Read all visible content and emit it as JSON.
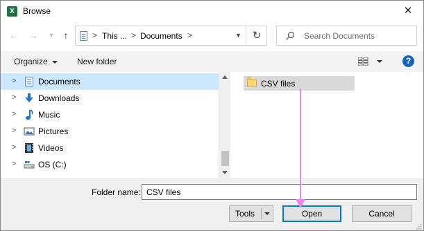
{
  "window": {
    "title": "Browse",
    "app_icon": "excel-icon",
    "close_glyph": "✕"
  },
  "nav": {
    "back_icon": "arrow-left-icon",
    "forward_icon": "arrow-right-icon",
    "recent_icon": "chevron-down-icon",
    "up_icon": "arrow-up-icon"
  },
  "address": {
    "crumbs": [
      "This ...",
      "Documents"
    ],
    "refresh_icon": "refresh-icon"
  },
  "search": {
    "placeholder": "Search Documents"
  },
  "toolbar": {
    "organize_label": "Organize",
    "new_folder_label": "New folder",
    "help_label": "?"
  },
  "sidebar": {
    "items": [
      {
        "label": "Documents",
        "icon": "documents-icon",
        "selected": true
      },
      {
        "label": "Downloads",
        "icon": "download-icon"
      },
      {
        "label": "Music",
        "icon": "music-icon"
      },
      {
        "label": "Pictures",
        "icon": "pictures-icon"
      },
      {
        "label": "Videos",
        "icon": "videos-icon"
      },
      {
        "label": "OS (C:)",
        "icon": "drive-icon"
      }
    ]
  },
  "files": {
    "items": [
      {
        "label": "CSV files",
        "icon": "folder-icon",
        "selected": true
      }
    ]
  },
  "footer": {
    "folder_name_label": "Folder name:",
    "folder_name_value": "CSV files",
    "tools_label": "Tools",
    "open_label": "Open",
    "cancel_label": "Cancel"
  },
  "colors": {
    "selection": "#cce8ff",
    "annotation_arrow": "#ee82ee",
    "help": "#1565c0"
  }
}
